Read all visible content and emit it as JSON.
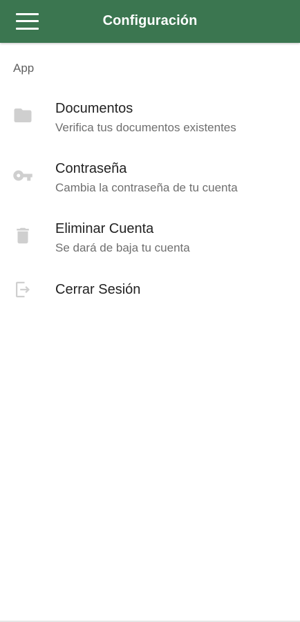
{
  "app_bar": {
    "title": "Configuración",
    "menu_icon": "hamburger-menu-icon",
    "background_color": "#3b7650"
  },
  "section": {
    "header": "App"
  },
  "items": [
    {
      "icon": "folder-icon",
      "title": "Documentos",
      "subtitle": "Verifica tus documentos existentes"
    },
    {
      "icon": "key-icon",
      "title": "Contraseña",
      "subtitle": "Cambia la contraseña de tu cuenta"
    },
    {
      "icon": "trash-icon",
      "title": "Eliminar Cuenta",
      "subtitle": "Se dará de baja tu cuenta"
    },
    {
      "icon": "logout-icon",
      "title": "Cerrar Sesión"
    }
  ]
}
